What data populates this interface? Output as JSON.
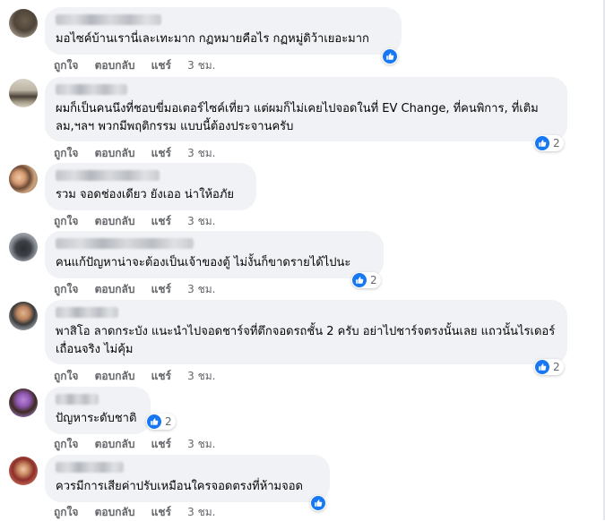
{
  "actions": {
    "like": "ถูกใจ",
    "reply": "ตอบกลับ",
    "share": "แชร์",
    "time": "3 ชม."
  },
  "colors": {
    "like_blue": "#1877f2",
    "bubble": "#f0f2f5",
    "meta_text": "#65676b"
  },
  "reaction_icon": "like-thumb-icon",
  "comments": [
    {
      "text": "มอไซค์บ้านเรานี่เละเทะมาก กฏหมายคือไร กฏหมู่ดิว้าเยอะมาก",
      "reaction_count": ""
    },
    {
      "text": "ผมก็เป็นคนนึงที่ชอบขี่มอเตอร์ไซค์เที่ยว แต่ผมก็ไม่เคยไปจอดในที่ EV Change, ที่คนพิการ, ที่เติมลม,ฯลฯ พวกมีพฤติกรรม แบบนี้ต้องประจานครับ",
      "reaction_count": "2"
    },
    {
      "text": "รวม จอดช่องเดียว ยังเออ น่าให้อภัย",
      "reaction_count": ""
    },
    {
      "text": "คนแก้ปัญหาน่าจะต้องเป็นเจ้าของตู้ ไม่งั้นก็ขาดรายได้ไปนะ",
      "reaction_count": "2"
    },
    {
      "text": "พาสิโอ ลาดกระบัง แนะนำไปจอดชาร์จที่ตึกจอดรถชั้น 2 ครับ อย่าไปชาร์จตรงนั้นเลย แถวนั้นไรเดอร์เถื่อนจริง ไม่คุ้ม",
      "reaction_count": "2"
    },
    {
      "text": "ปัญหาระดับชาติ",
      "reaction_count": "2"
    },
    {
      "text": "ควรมีการเสียค่าปรับเหมือนใครจอดตรงที่ห้ามจอด",
      "reaction_count": ""
    }
  ]
}
